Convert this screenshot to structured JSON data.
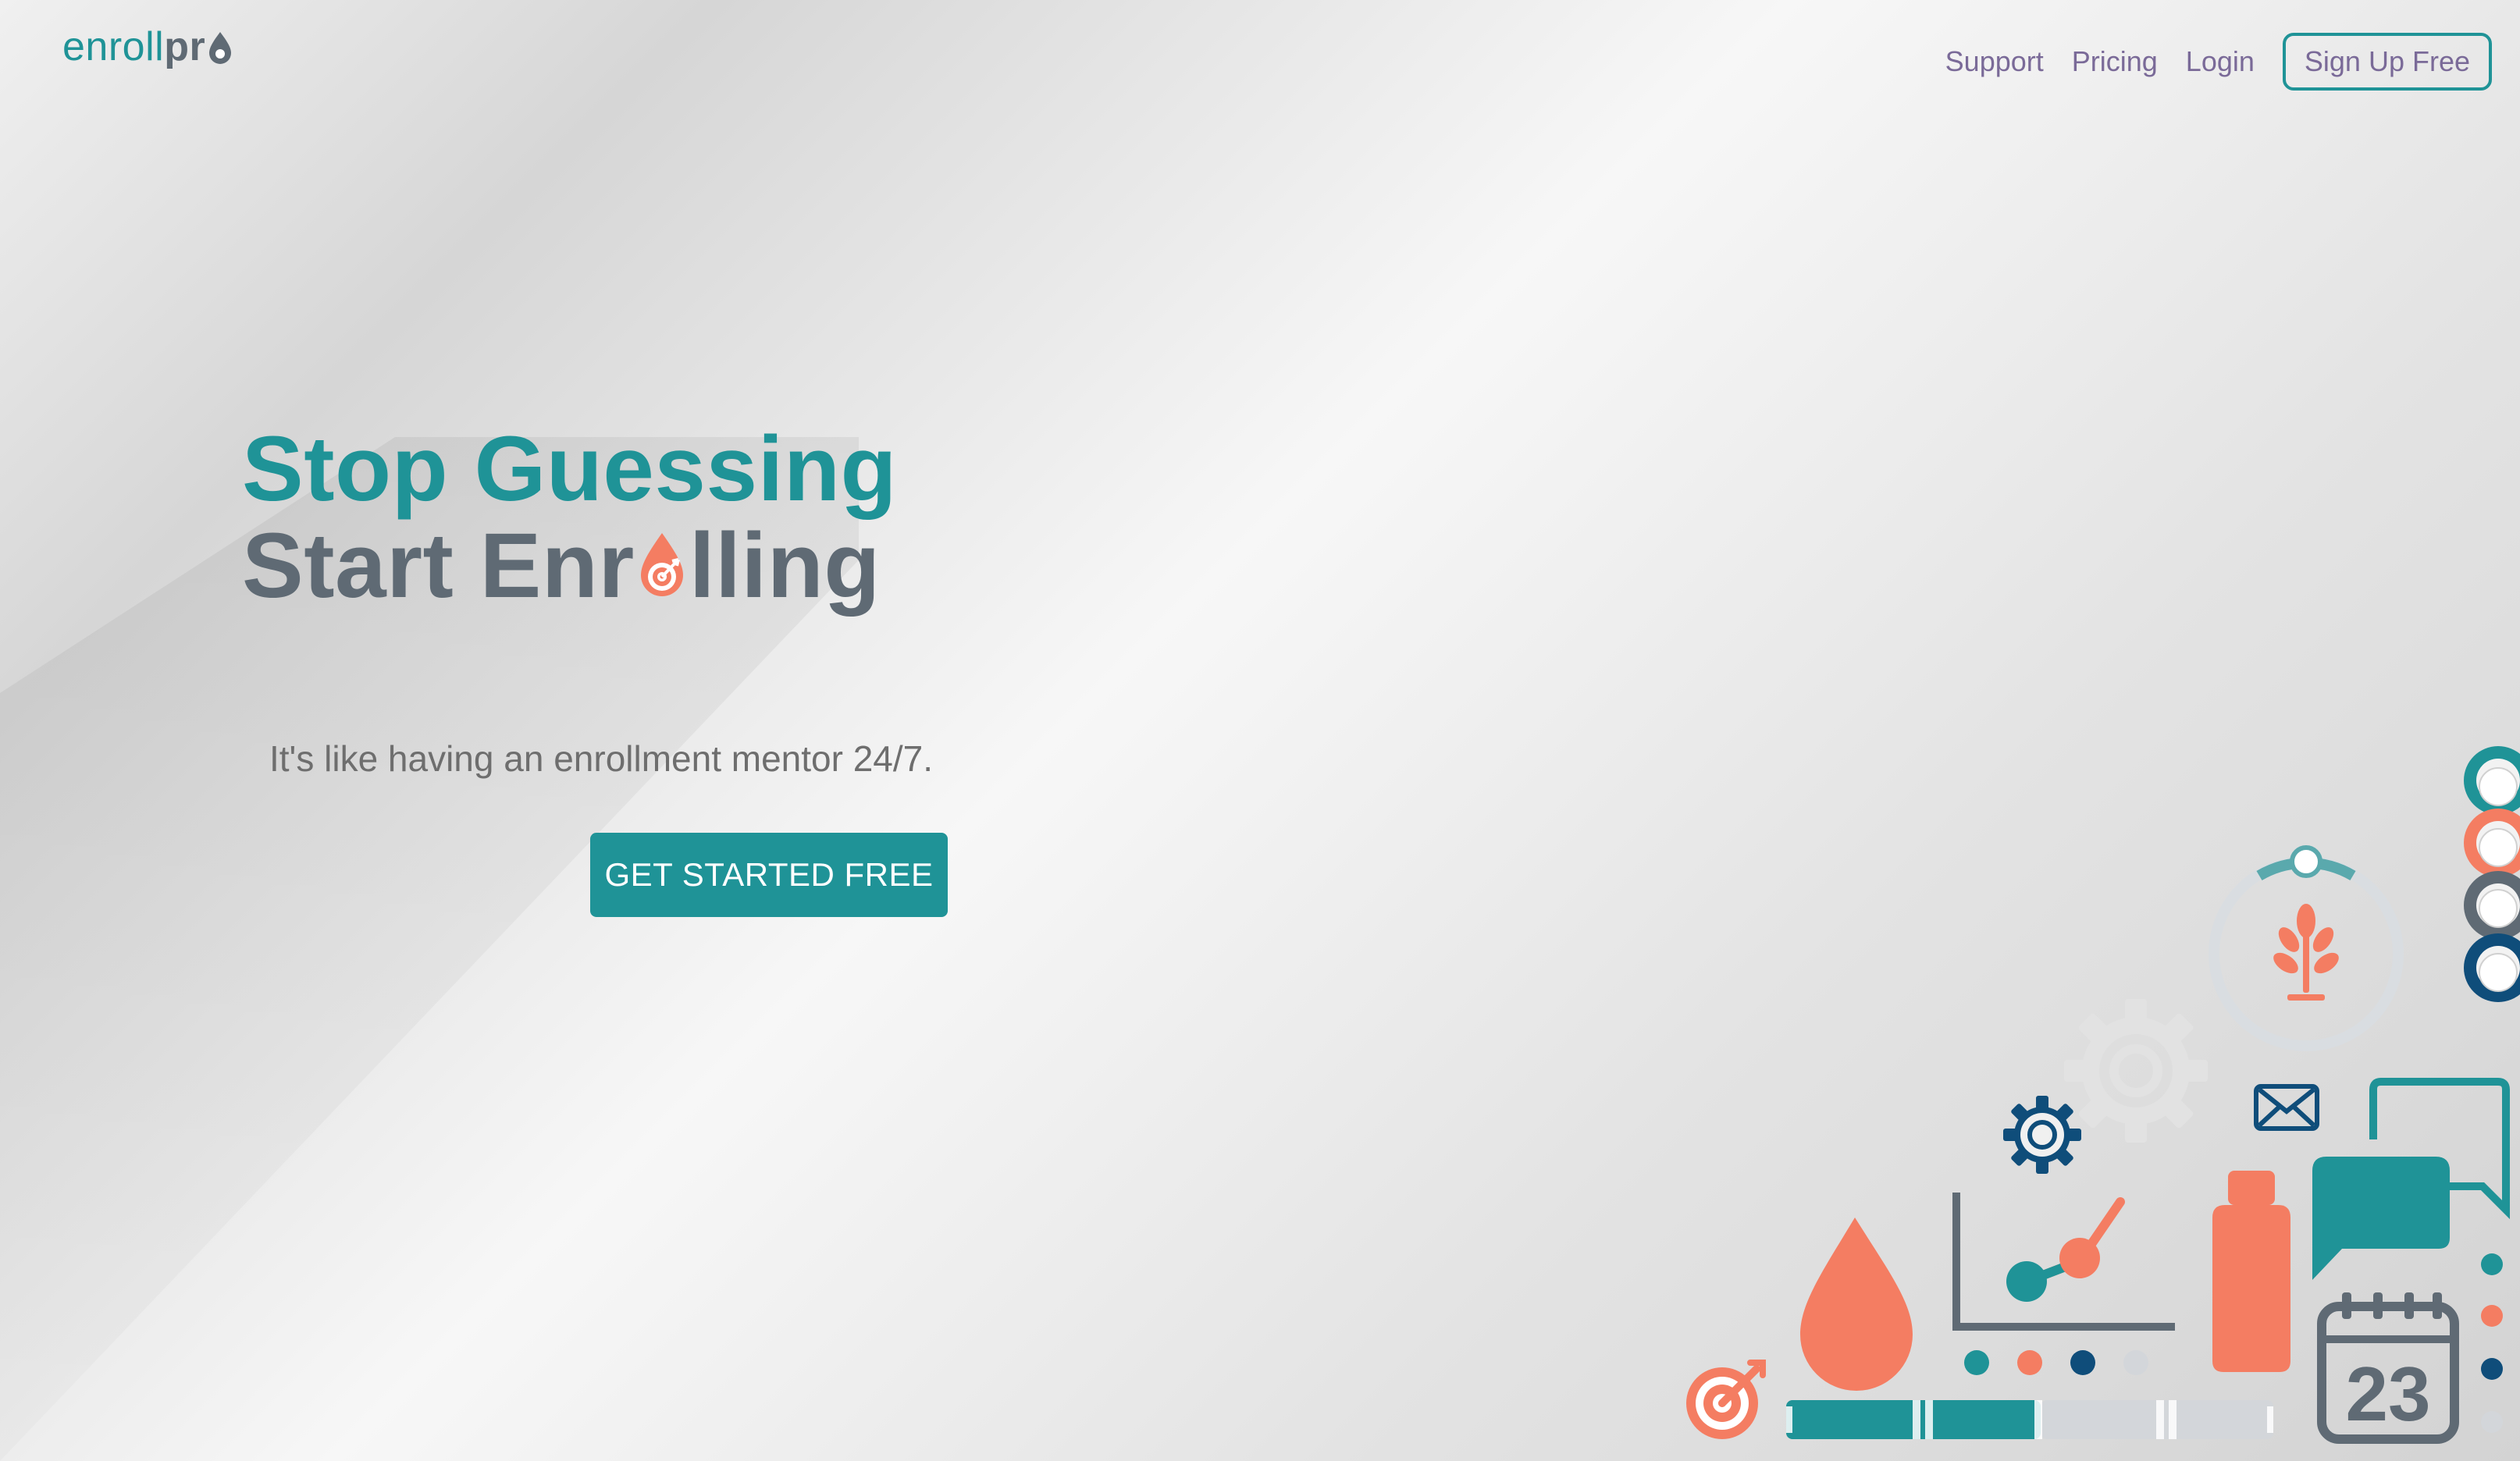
{
  "brand": {
    "text_main": "enroll",
    "text_end": "pr",
    "colors": {
      "teal": "#1f9397",
      "slate": "#5f6a74",
      "coral": "#f47d62",
      "navy": "#0f4d7a",
      "purple": "#7a6a98"
    }
  },
  "nav": {
    "support": "Support",
    "pricing": "Pricing",
    "login": "Login",
    "signup": "Sign Up Free"
  },
  "hero": {
    "line1": "Stop Guessing",
    "line2_a": "Start Enr",
    "line2_b": "lling",
    "subtitle": "It's like having an enrollment mentor 24/7.",
    "cta": "GET STARTED FREE"
  },
  "illustration": {
    "calendar_day": "23"
  }
}
